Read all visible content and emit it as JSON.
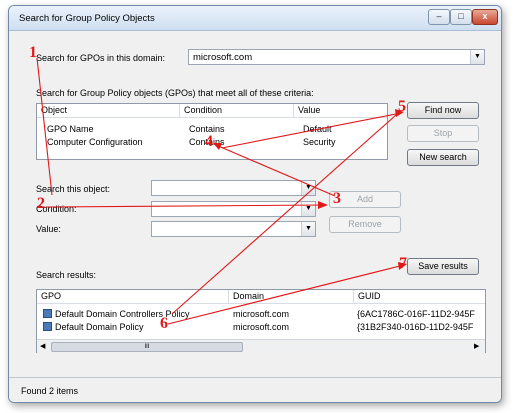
{
  "window": {
    "title": "Search for Group Policy Objects",
    "controls": {
      "minimize": "–",
      "maximize": "□",
      "close": "x"
    }
  },
  "domain_label": "Search for GPOs in this domain:",
  "domain_value": "microsoft.com",
  "criteria_label": "Search for Group Policy objects (GPOs) that meet all of these criteria:",
  "criteria_table": {
    "columns": [
      "Object",
      "Condition",
      "Value"
    ],
    "rows": [
      {
        "object": "GPO Name",
        "condition": "Contains",
        "value": "Default"
      },
      {
        "object": "Computer Configuration",
        "condition": "Contains",
        "value": "Security"
      }
    ]
  },
  "buttons": {
    "find_now": "Find now",
    "stop": "Stop",
    "new_search": "New search",
    "add": "Add",
    "remove": "Remove",
    "save_results": "Save results"
  },
  "form": {
    "object_label": "Search this object:",
    "condition_label": "Condition:",
    "value_label": "Value:"
  },
  "results_label": "Search results:",
  "results_table": {
    "columns": [
      "GPO",
      "Domain",
      "GUID"
    ],
    "rows": [
      {
        "gpo": "Default Domain Controllers Policy",
        "domain": "microsoft.com",
        "guid": "{6AC1786C-016F-11D2-945F"
      },
      {
        "gpo": "Default Domain Policy",
        "domain": "microsoft.com",
        "guid": "{31B2F340-016D-11D2-945F"
      }
    ],
    "scroll_thumb": "III"
  },
  "status": "Found 2 items",
  "annotations": [
    "1",
    "2",
    "3",
    "4",
    "5",
    "6",
    "7"
  ],
  "colors": {
    "annotation": "#e01818",
    "title_bar": "#cfdff0"
  }
}
